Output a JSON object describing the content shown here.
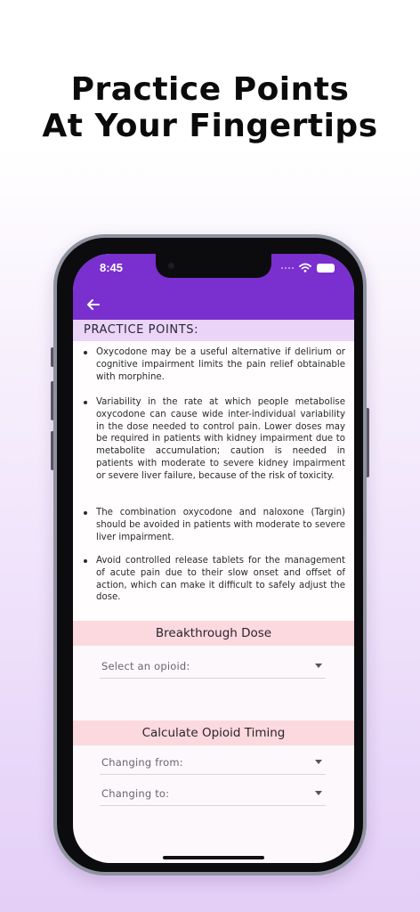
{
  "promo": {
    "line1": "Practice Points",
    "line2": "At Your Fingertips"
  },
  "status_bar": {
    "time": "8:45"
  },
  "app_bar": {
    "color": "#7a2fcf",
    "back_icon": "arrow-left-icon"
  },
  "practice_points": {
    "heading": "PRACTICE POINTS:",
    "items": [
      "Oxycodone may be a useful alternative if delirium or cognitive impairment limits the pain relief obtainable with morphine.",
      "Variability in the rate at which people metabolise oxycodone can cause wide inter-individual variability in the dose needed to control pain. Lower doses may be required in patients with kidney impairment due to metabolite accumulation; caution is needed in patients with moderate to severe kidney impairment or severe liver failure, because of the risk of toxicity.",
      "The combination oxycodone and naloxone (Targin) should be avoided in patients with moderate to severe liver impairment.",
      "Avoid controlled release tablets for the management of acute pain due to their slow onset and offset of action, which can make it difficult to safely adjust the dose."
    ]
  },
  "breakthrough": {
    "title": "Breakthrough Dose",
    "select_label": "Select an opioid:"
  },
  "timing": {
    "title": "Calculate Opioid Timing",
    "from_label": "Changing from:",
    "to_label": "Changing to:"
  },
  "colors": {
    "section_band": "#fcd9de",
    "heading_band": "#ead5f8"
  }
}
